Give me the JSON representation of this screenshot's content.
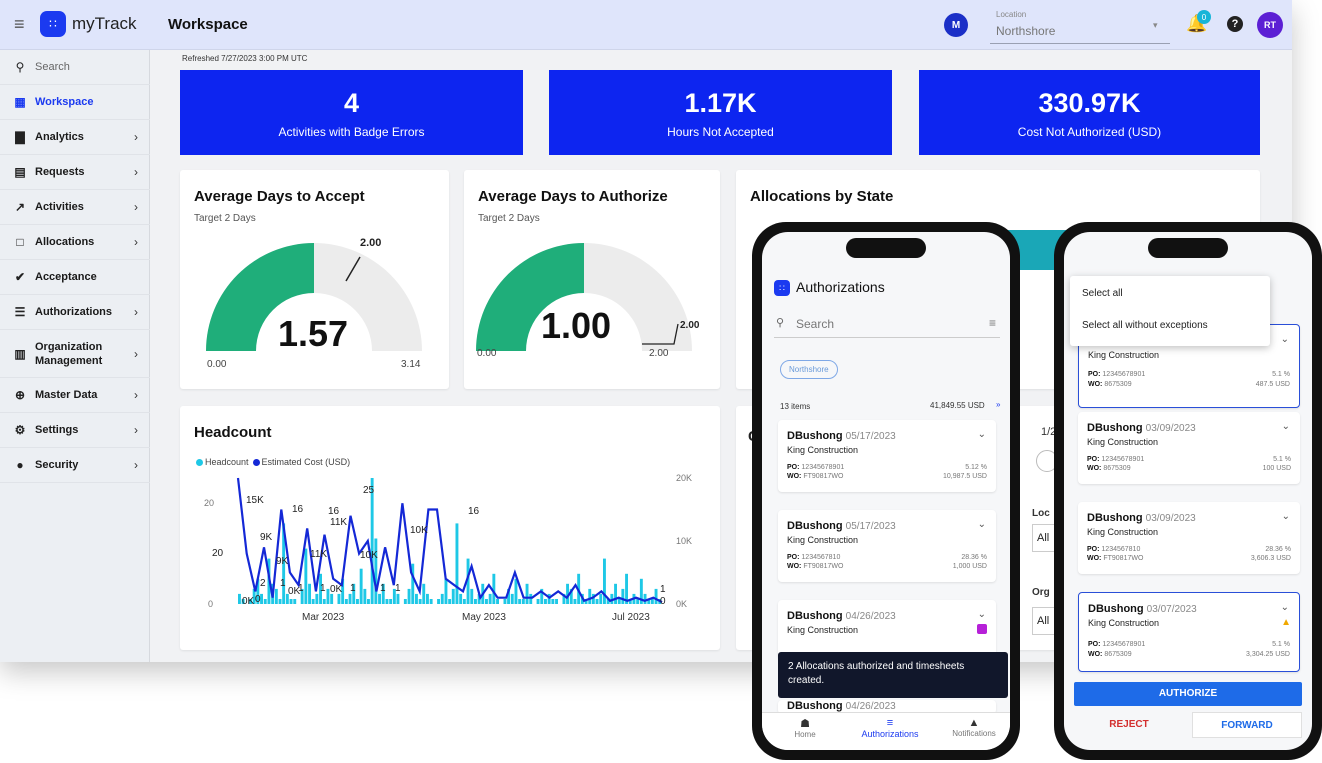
{
  "app": {
    "logo_text": "myTrack",
    "page_title": "Workspace"
  },
  "topbar": {
    "location_label": "Location",
    "location_value": "Northshore",
    "notification_count": "0",
    "user_initial": "M",
    "user_initials": "RT"
  },
  "sidebar": {
    "search_placeholder": "Search",
    "items": [
      {
        "label": "Workspace",
        "icon": "dashboard-icon",
        "chevron": false,
        "active": true
      },
      {
        "label": "Analytics",
        "icon": "bar-chart-icon",
        "chevron": true
      },
      {
        "label": "Requests",
        "icon": "briefcase-icon",
        "chevron": true
      },
      {
        "label": "Activities",
        "icon": "trend-line-icon",
        "chevron": true
      },
      {
        "label": "Allocations",
        "icon": "clipboard-icon",
        "chevron": true
      },
      {
        "label": "Acceptance",
        "icon": "check-circle-icon",
        "chevron": false
      },
      {
        "label": "Authorizations",
        "icon": "checklist-icon",
        "chevron": true
      },
      {
        "label": "Organization Management",
        "icon": "building-icon",
        "chevron": true
      },
      {
        "label": "Master Data",
        "icon": "globe-icon",
        "chevron": true
      },
      {
        "label": "Settings",
        "icon": "gear-icon",
        "chevron": true
      },
      {
        "label": "Security",
        "icon": "user-circle-icon",
        "chevron": true
      }
    ]
  },
  "main": {
    "refreshed": "Refreshed 7/27/2023 3:00 PM UTC",
    "kpis": [
      {
        "value": "4",
        "label": "Activities with Badge Errors"
      },
      {
        "value": "1.17K",
        "label": "Hours Not Accepted"
      },
      {
        "value": "330.97K",
        "label": "Cost Not Authorized (USD)"
      }
    ],
    "gauge_accept": {
      "title": "Average Days to Accept",
      "subtitle": "Target 2 Days",
      "value": "1.57",
      "min": "0.00",
      "max": "3.14",
      "target": "2.00",
      "fraction": 0.5
    },
    "gauge_authorize": {
      "title": "Average Days to Authorize",
      "subtitle": "Target 2 Days",
      "value": "1.00",
      "min": "0.00",
      "max": "2.00",
      "target": "2.00",
      "fraction": 0.5
    },
    "allocations_title": "Allocations by State",
    "headcount_title": "Headcount",
    "legend": {
      "headcount": "Headcount",
      "cost": "Estimated Cost (USD)"
    },
    "partial": {
      "letter": "C",
      "page": "1/2",
      "loc": "Loc",
      "all1": "All",
      "org": "Org",
      "all2": "All"
    }
  },
  "chart_data": {
    "type": "bar",
    "title": "Headcount",
    "series": [
      {
        "name": "Headcount",
        "axis": "left",
        "color": "#1ec8e6"
      },
      {
        "name": "Estimated Cost (USD)",
        "axis": "right",
        "color": "#1428d6"
      }
    ],
    "x_ticks": [
      "Mar 2023",
      "May 2023",
      "Jul 2023"
    ],
    "y_left_ticks": [
      "0",
      "20"
    ],
    "y_right_ticks": [
      "0K",
      "10K",
      "20K"
    ],
    "ylim_left": [
      0,
      25
    ],
    "ylim_right": [
      0,
      20
    ],
    "headcount_bars": [
      2,
      1,
      0,
      1,
      3,
      5,
      2,
      1,
      9,
      4,
      3,
      1,
      16,
      2,
      1,
      1,
      0,
      3,
      11,
      4,
      1,
      2,
      6,
      1,
      3,
      2,
      0,
      2,
      5,
      1,
      2,
      4,
      1,
      7,
      3,
      1,
      25,
      13,
      2,
      4,
      1,
      1,
      3,
      2,
      0,
      1,
      3,
      8,
      2,
      1,
      4,
      2,
      1,
      0,
      1,
      2,
      5,
      1,
      3,
      16,
      2,
      1,
      9,
      3,
      1,
      2,
      4,
      1,
      2,
      6,
      1,
      0,
      1,
      3,
      2,
      5,
      1,
      1,
      4,
      2,
      0,
      1,
      3,
      1,
      2,
      1,
      1,
      0,
      2,
      4,
      3,
      1,
      6,
      2,
      1,
      3,
      2,
      1,
      2,
      9,
      1,
      2,
      4,
      1,
      3,
      6,
      1,
      2,
      1,
      5,
      2,
      1,
      1,
      3,
      1
    ],
    "cost_points": [
      [
        0,
        20
      ],
      [
        1,
        8
      ],
      [
        2,
        2
      ],
      [
        3,
        9
      ],
      [
        4,
        1
      ],
      [
        5,
        15
      ],
      [
        6,
        5
      ],
      [
        7,
        3
      ],
      [
        8,
        12
      ],
      [
        9,
        2
      ],
      [
        10,
        11
      ],
      [
        11,
        4
      ],
      [
        12,
        3
      ],
      [
        13,
        14
      ],
      [
        14,
        8
      ],
      [
        15,
        10
      ],
      [
        16,
        2
      ],
      [
        17,
        9
      ],
      [
        18,
        3
      ],
      [
        19,
        16
      ],
      [
        20,
        5
      ],
      [
        21,
        2
      ],
      [
        22,
        15
      ],
      [
        23,
        15
      ],
      [
        24,
        4
      ],
      [
        25,
        3
      ],
      [
        26,
        2
      ],
      [
        27,
        6
      ],
      [
        28,
        1
      ],
      [
        29,
        3
      ],
      [
        30,
        1
      ],
      [
        31,
        1
      ],
      [
        32,
        5
      ],
      [
        33,
        1
      ],
      [
        34,
        1
      ],
      [
        35,
        2
      ],
      [
        36,
        1
      ],
      [
        37,
        2
      ],
      [
        38,
        1
      ],
      [
        39,
        3
      ],
      [
        40,
        0.5
      ],
      [
        41,
        1
      ],
      [
        42,
        2
      ],
      [
        43,
        0.5
      ],
      [
        44,
        1
      ],
      [
        45,
        0.5
      ],
      [
        46,
        1
      ],
      [
        47,
        0.5
      ],
      [
        48,
        1
      ],
      [
        49,
        0.3
      ]
    ],
    "data_labels": {
      "headcount": [
        "20",
        "16",
        "16",
        "25",
        "16",
        "2",
        "1",
        "0",
        "1",
        "1",
        "1",
        "1",
        "1",
        "1",
        "0"
      ],
      "cost": [
        "15K",
        "9K",
        "9K",
        "11K",
        "11K",
        "10K",
        "10K",
        "0K",
        "0K",
        "0K"
      ]
    }
  },
  "phone_left": {
    "title": "Authorizations",
    "search_placeholder": "Search",
    "chip": "Northshore",
    "items_count": "13 items",
    "total": "41,849.55 USD",
    "cards": [
      {
        "name": "DBushong",
        "date": "05/17/2023",
        "company": "King Construction",
        "po_label": "PO:",
        "po": "12345678901",
        "wo_label": "WO:",
        "wo": "FT90817WO",
        "pct": "5.12 %",
        "amount": "10,987.5 USD"
      },
      {
        "name": "DBushong",
        "date": "05/17/2023",
        "company": "King Construction",
        "po_label": "PO:",
        "po": "1234567810",
        "wo_label": "WO:",
        "wo": "FT90817WO",
        "pct": "28.36 %",
        "amount": "1,000 USD"
      },
      {
        "name": "DBushong",
        "date": "04/26/2023",
        "company": "King Construction"
      },
      {
        "name": "DBushong",
        "date": "04/26/2023"
      }
    ],
    "toast": "2 Allocations authorized and timesheets created.",
    "nav": [
      {
        "label": "Home",
        "icon": "home-icon"
      },
      {
        "label": "Authorizations",
        "icon": "checklist-icon"
      },
      {
        "label": "Notifications",
        "icon": "bell-icon"
      }
    ]
  },
  "phone_right": {
    "menu": [
      "Select all",
      "Select all without exceptions"
    ],
    "cards": [
      {
        "company": "King Construction",
        "po_label": "PO:",
        "po": "12345678901",
        "wo_label": "WO:",
        "wo": "8675309",
        "pct": "5.1 %",
        "amount": "487.5 USD"
      },
      {
        "name": "DBushong",
        "date": "03/09/2023",
        "company": "King Construction",
        "po_label": "PO:",
        "po": "12345678901",
        "wo_label": "WO:",
        "wo": "8675309",
        "pct": "5.1 %",
        "amount": "100 USD"
      },
      {
        "name": "DBushong",
        "date": "03/09/2023",
        "company": "King Construction",
        "po_label": "PO:",
        "po": "1234567810",
        "wo_label": "WO:",
        "wo": "FT90817WO",
        "pct": "28.36 %",
        "amount": "3,606.3 USD"
      },
      {
        "name": "DBushong",
        "date": "03/07/2023",
        "company": "King Construction",
        "po_label": "PO:",
        "po": "12345678901",
        "wo_label": "WO:",
        "wo": "8675309",
        "pct": "5.1 %",
        "amount": "3,304.25 USD"
      }
    ],
    "authorize": "AUTHORIZE",
    "reject": "REJECT",
    "forward": "FORWARD"
  },
  "colors": {
    "brand": "#0d25f0",
    "gauge": "#1fae7a",
    "headcount": "#1ec8e6",
    "cost": "#1428d6",
    "reject": "#d32f2f"
  }
}
